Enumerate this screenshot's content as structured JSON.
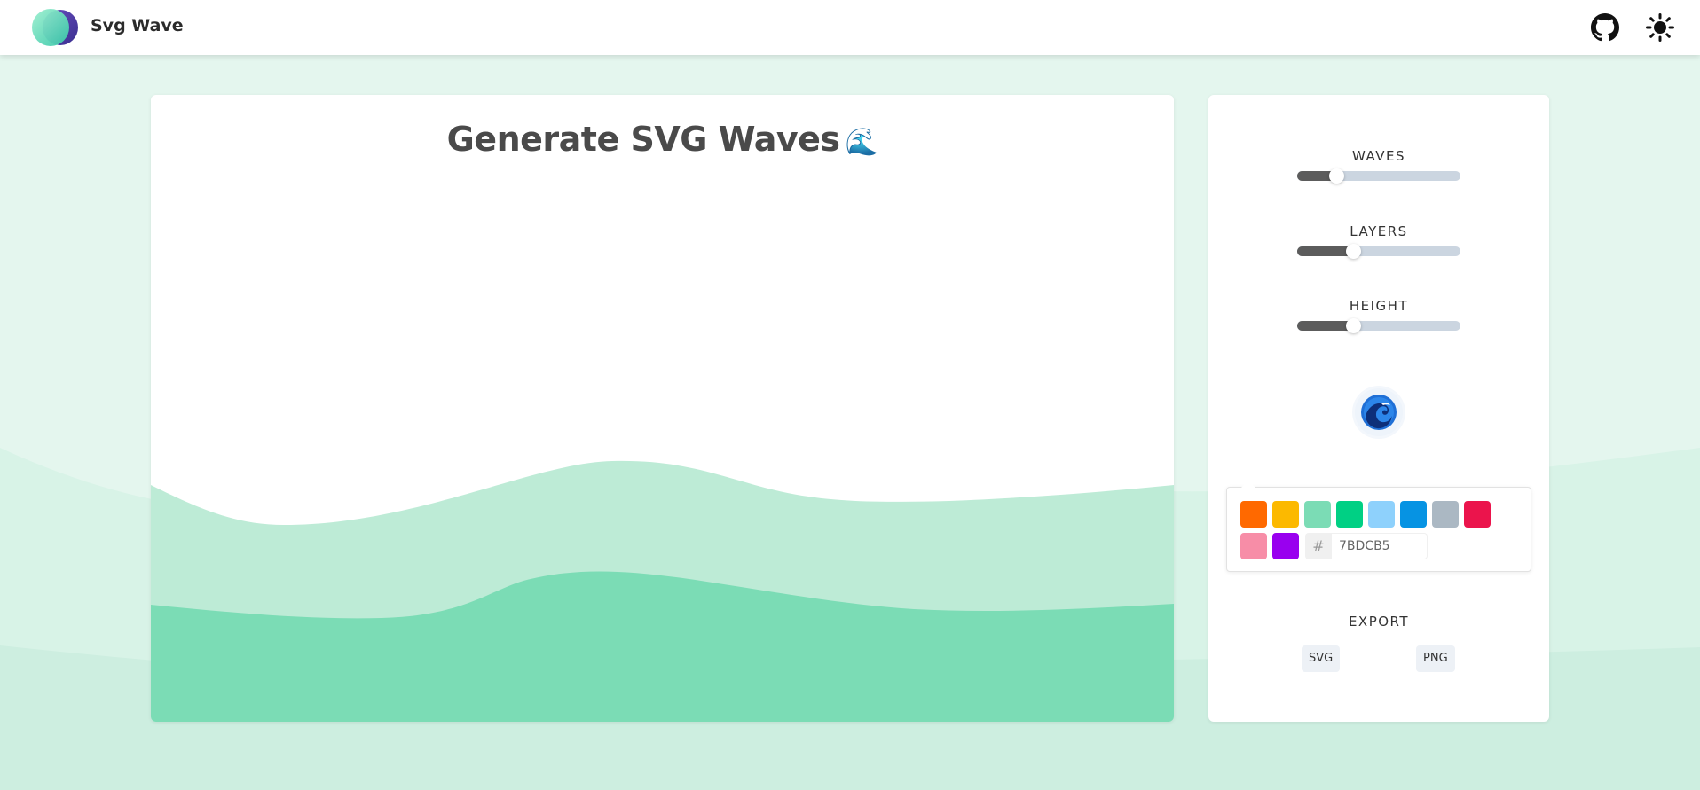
{
  "app": {
    "name": "Svg Wave"
  },
  "header": {
    "github_icon": "github-icon",
    "theme_icon": "sun-icon"
  },
  "canvas": {
    "title": "Generate SVG Waves",
    "title_emoji": "🌊"
  },
  "controls": {
    "waves": {
      "label": "WAVES",
      "value_fraction": 0.24
    },
    "layers": {
      "label": "LAYERS",
      "value_fraction": 0.34
    },
    "height": {
      "label": "HEIGHT",
      "value_fraction": 0.34
    },
    "randomize_icon": "wave-randomize-icon",
    "colors": {
      "swatches": [
        "#FF6900",
        "#FCB900",
        "#7BDCB5",
        "#00D084",
        "#8ED1FC",
        "#0693E3",
        "#ABB8C3",
        "#EB144C",
        "#F78DA7",
        "#9900EF"
      ],
      "hex_prefix": "#",
      "hex_value": "7BDCB5"
    },
    "export": {
      "label": "EXPORT",
      "svg_label": "SVG",
      "png_label": "PNG"
    }
  },
  "theme": {
    "wave_front": "#7BDCB5",
    "wave_back": "#BDEBD6",
    "background": "#E4F6EE"
  }
}
